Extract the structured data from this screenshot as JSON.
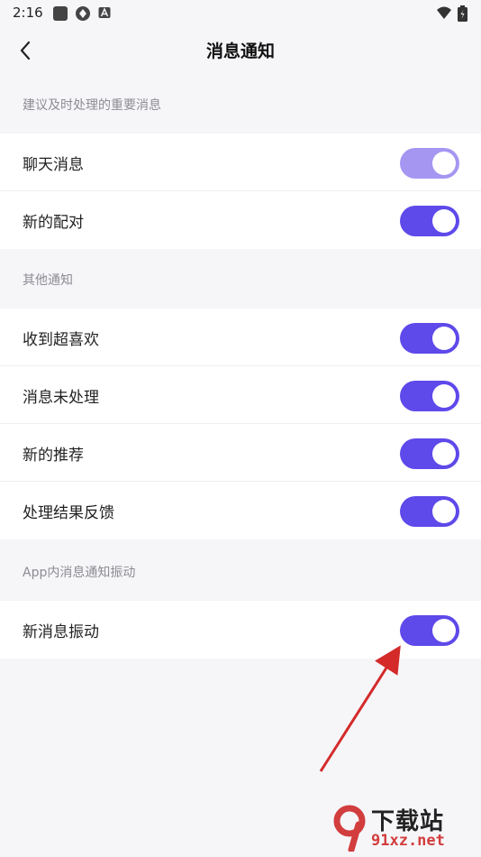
{
  "status_bar": {
    "time": "2:16"
  },
  "header": {
    "title": "消息通知",
    "back_icon": "chevron-left-icon"
  },
  "sections": [
    {
      "title": "建议及时处理的重要消息",
      "items": [
        {
          "label": "聊天消息",
          "on": true,
          "disabled": true
        },
        {
          "label": "新的配对",
          "on": true,
          "disabled": false
        }
      ]
    },
    {
      "title": "其他通知",
      "items": [
        {
          "label": "收到超喜欢",
          "on": true,
          "disabled": false
        },
        {
          "label": "消息未处理",
          "on": true,
          "disabled": false
        },
        {
          "label": "新的推荐",
          "on": true,
          "disabled": false
        },
        {
          "label": "处理结果反馈",
          "on": true,
          "disabled": false
        }
      ]
    },
    {
      "title": "App内消息通知振动",
      "items": [
        {
          "label": "新消息振动",
          "on": true,
          "disabled": false
        }
      ]
    }
  ],
  "watermark": {
    "text": "下载站",
    "url": "91xz.net"
  },
  "colors": {
    "accent": "#5e49ea",
    "accent_disabled": "#a596f2",
    "background": "#f6f6f9",
    "annotation_arrow": "#d42a2a"
  }
}
